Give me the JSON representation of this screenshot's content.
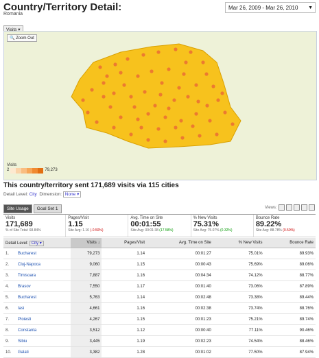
{
  "header": {
    "title": "Country/Territory Detail:",
    "subtitle": "Romania",
    "date_range": "Mar 26, 2009 - Mar 26, 2010"
  },
  "view_tab": "Visits",
  "map": {
    "zoom_out": "Zoom Out",
    "legend_title": "Visits",
    "legend_min": "2",
    "legend_max": "79,273",
    "fill_color": "#f7c21d",
    "dot_color": "#ec7a30",
    "legend_colors": [
      "#fde9d0",
      "#fbd3a8",
      "#f9bd80",
      "#f6a658",
      "#f08a30",
      "#e26f12"
    ]
  },
  "summary": "This country/territory sent 171,689 visits via 115 cities",
  "detail": {
    "level_label": "Detail Level:",
    "level_value": "City",
    "dimension_label": "Dimension:",
    "dimension_value": "None"
  },
  "tabs": [
    "Site Usage",
    "Goal Set 1"
  ],
  "views_label": "Views:",
  "metrics": [
    {
      "label": "Visits",
      "value": "171,689",
      "sub": "% of Site Total: 68.84%",
      "delta": ""
    },
    {
      "label": "Pages/Visit",
      "value": "1.15",
      "sub": "Site Avg: 1.16",
      "delta": "(-0.50%)"
    },
    {
      "label": "Avg. Time on Site",
      "value": "00:01:55",
      "sub": "Site Avg: 00:01:38",
      "delta": "(17.58%)"
    },
    {
      "label": "% New Visits",
      "value": "75.31%",
      "sub": "Site Avg: 75.07%",
      "delta": "(0.32%)"
    },
    {
      "label": "Bounce Rate",
      "value": "89.22%",
      "sub": "Site Avg: 88.78%",
      "delta": "(0.50%)"
    }
  ],
  "table": {
    "headers": {
      "detail_level": "Detail Level:",
      "city": "City",
      "visits": "Visits ↓",
      "pages": "Pages/Visit",
      "time": "Avg. Time on Site",
      "new": "% New Visits",
      "bounce": "Bounce Rate"
    },
    "rows": [
      {
        "n": "1.",
        "city": "Bucharest",
        "visits": "79,273",
        "pages": "1.14",
        "time": "00:01:27",
        "new": "75.01%",
        "bounce": "89.93%"
      },
      {
        "n": "2.",
        "city": "Cluj-Napoca",
        "visits": "9,060",
        "pages": "1.15",
        "time": "00:00:43",
        "new": "75.69%",
        "bounce": "89.06%"
      },
      {
        "n": "3.",
        "city": "Timisoara",
        "visits": "7,887",
        "pages": "1.16",
        "time": "00:04:34",
        "new": "74.12%",
        "bounce": "88.77%"
      },
      {
        "n": "4.",
        "city": "Brasov",
        "visits": "7,550",
        "pages": "1.17",
        "time": "00:01:40",
        "new": "73.06%",
        "bounce": "87.89%"
      },
      {
        "n": "5.",
        "city": "Bucharest",
        "visits": "5,763",
        "pages": "1.14",
        "time": "00:02:48",
        "new": "73.38%",
        "bounce": "89.44%"
      },
      {
        "n": "6.",
        "city": "Iasi",
        "visits": "4,661",
        "pages": "1.16",
        "time": "00:02:38",
        "new": "73.74%",
        "bounce": "88.76%"
      },
      {
        "n": "7.",
        "city": "Ploiesti",
        "visits": "4,267",
        "pages": "1.15",
        "time": "00:01:23",
        "new": "75.21%",
        "bounce": "89.74%"
      },
      {
        "n": "8.",
        "city": "Constanta",
        "visits": "3,512",
        "pages": "1.12",
        "time": "00:00:40",
        "new": "77.11%",
        "bounce": "90.46%"
      },
      {
        "n": "9.",
        "city": "Sibiu",
        "visits": "3,445",
        "pages": "1.19",
        "time": "00:02:23",
        "new": "74.54%",
        "bounce": "88.46%"
      },
      {
        "n": "10.",
        "city": "Galati",
        "visits": "3,382",
        "pages": "1.28",
        "time": "00:01:02",
        "new": "77.50%",
        "bounce": "87.94%"
      }
    ]
  }
}
